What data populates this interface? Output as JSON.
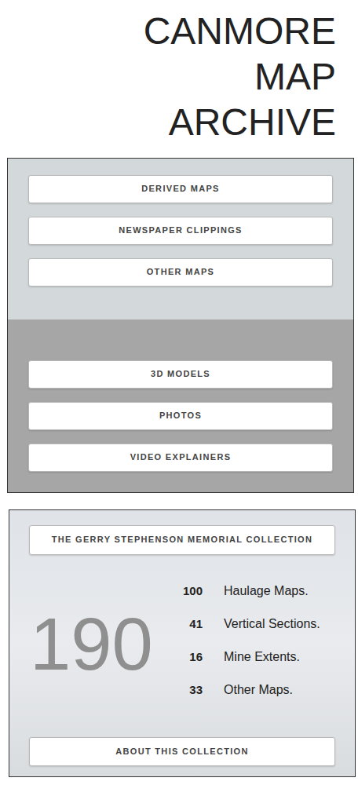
{
  "header": {
    "title_lines": [
      "CANMORE",
      "MAP",
      "ARCHIVE"
    ]
  },
  "resource_panel": {
    "groups": [
      {
        "buttons": [
          "DERIVED MAPS",
          "NEWSPAPER CLIPPINGS",
          "OTHER MAPS"
        ]
      },
      {
        "buttons": [
          "3D MODELS",
          "PHOTOS",
          "VIDEO EXPLAINERS"
        ]
      }
    ]
  },
  "collection": {
    "title": "THE GERRY STEPHENSON MEMORIAL COLLECTION",
    "total": "190",
    "stats": [
      {
        "count": "100",
        "label": "Haulage Maps."
      },
      {
        "count": "41",
        "label": "Vertical Sections."
      },
      {
        "count": "16",
        "label": "Mine Extents."
      },
      {
        "count": "33",
        "label": "Other Maps."
      }
    ],
    "about_button": "ABOUT THIS COLLECTION"
  }
}
